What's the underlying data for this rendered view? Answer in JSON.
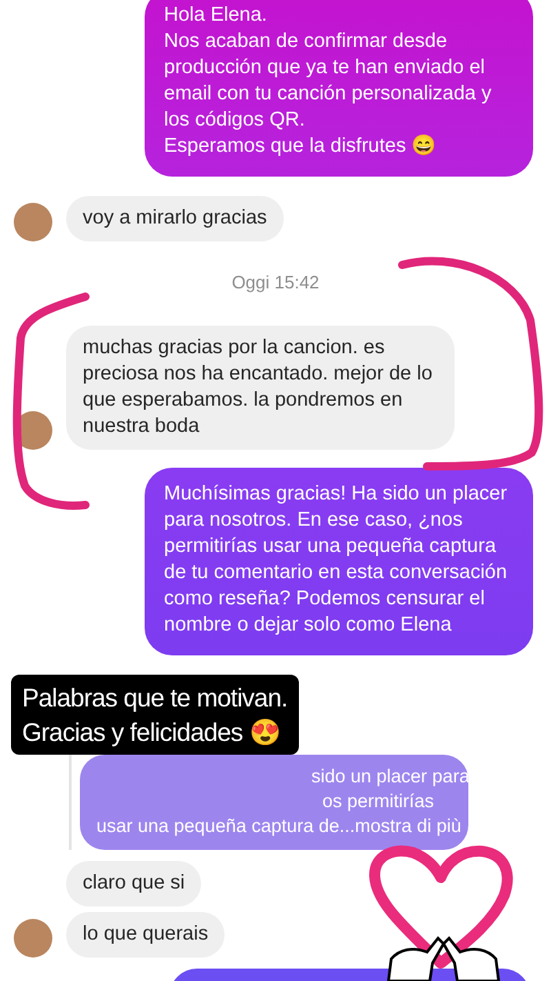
{
  "messages": [
    {
      "kind": "outgoing",
      "text": "Hola Elena.\nNos acaban de confirmar desde producción que ya te han enviado el email con tu canción personalizada y los códigos QR.\nEsperamos que la disfrutes 😄"
    },
    {
      "kind": "incoming",
      "text": "voy a mirarlo gracias",
      "avatar": true
    },
    {
      "kind": "timestamp",
      "text": "Oggi 15:42"
    },
    {
      "kind": "incoming",
      "text": "muchas gracias por la cancion. es preciosa nos ha encantado. mejor de lo que esperabamos. la pondremos en nuestra boda",
      "avatar": true
    },
    {
      "kind": "outgoing",
      "text": "Muchísimas gracias! Ha sido un placer para nosotros. En ese caso, ¿nos permitirías usar una pequeña captura de tu comentario en esta conversación como reseña? Podemos censurar el nombre o dejar solo como Elena"
    },
    {
      "kind": "reply_quote",
      "lines": [
        "sido un placer para",
        "os permitirías",
        "usar una pequeña captura de...mostra di più"
      ]
    },
    {
      "kind": "incoming",
      "text": "claro que si",
      "avatar": false
    },
    {
      "kind": "incoming",
      "text": "lo que querais",
      "avatar": true
    },
    {
      "kind": "outgoing_cut"
    }
  ],
  "sticker": {
    "lines": [
      "Palabras que te motivan.",
      "Gracias y felicidades 😍"
    ]
  }
}
